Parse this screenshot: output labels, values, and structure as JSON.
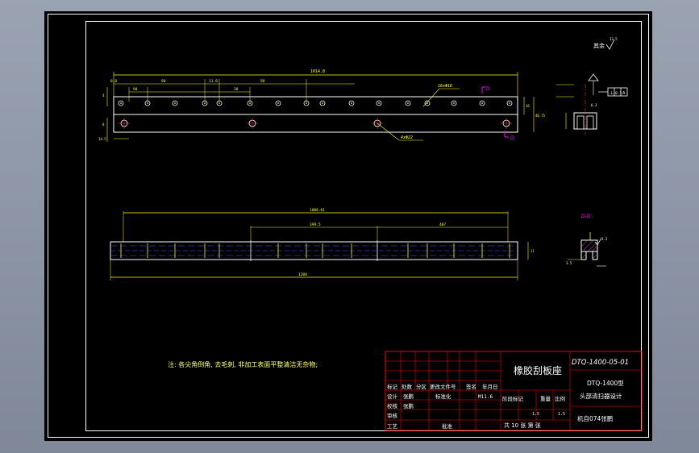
{
  "drawing": {
    "top_view": {
      "overall_dim": "1014.8",
      "dims": [
        "8.8",
        "90",
        "90",
        "11.8",
        "30",
        "90"
      ],
      "height_dims": [
        "16",
        "40.75"
      ],
      "left_dims": [
        "4",
        "8",
        "14.5"
      ],
      "hole_note_top": "16xΦ16",
      "hole_note_bottom": "4xΦ22",
      "section_label_top": "D",
      "section_label_bottom": "D"
    },
    "front_view": {
      "top_dim": "1000.01",
      "mid_dim_left": "399.5",
      "mid_dim_right": "407",
      "overall_dim": "1200",
      "right_dim": "11"
    },
    "detail_top": {
      "surface_note": "其余",
      "roughness": "12.5",
      "tol_frame": [
        "⊥",
        "0.1",
        "A"
      ],
      "roughness_small": "6.3"
    },
    "section_view": {
      "label": "D-D",
      "roughness": "3.2",
      "dim": "3.5"
    },
    "note": "注: 各尖角倒角, 去毛刺, 非加工表面平整清洁无杂物;"
  },
  "title_block": {
    "part_name": "橡胶刮板座",
    "drawing_no": "DTQ-1400-05-01",
    "assembly_line1": "DTQ-1400型",
    "assembly_line2": "头部清扫器设计",
    "material": "M11.6",
    "row_labels": [
      "标记",
      "处数",
      "分区",
      "更改文件号",
      "签名",
      "年月日"
    ],
    "role_labels": [
      "设计",
      "校核",
      "审核",
      "工艺"
    ],
    "designer": "张鹏",
    "standardization": "标准化",
    "approve": "批准",
    "stage_labels": [
      "阶段标记",
      "重量",
      "比例"
    ],
    "scale_values": [
      "1.5",
      "1.5"
    ],
    "sheet_info": "共 10 张 第 张",
    "school": "机自074张鹏"
  },
  "colors": {
    "line": "#ffffff",
    "dim": "#ffff00",
    "center": "#ff4040",
    "border": "#ff0000",
    "title_text": "#ffffff",
    "hidden": "#4060ff",
    "section": "#ff00ff",
    "note": "#ffff66"
  }
}
